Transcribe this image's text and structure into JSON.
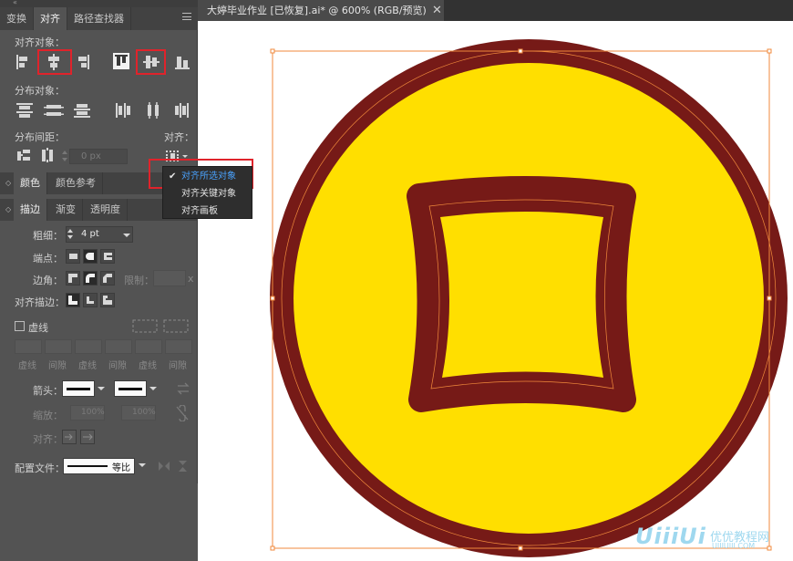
{
  "panel": {
    "tabs": [
      "变换",
      "对齐",
      "路径查找器"
    ],
    "align_objects_label": "对齐对象：",
    "distribute_objects_label": "分布对象：",
    "distribute_spacing_label": "分布间距：",
    "align_to_label": "对齐：",
    "spacing_value": "0 px",
    "align_to_menu": {
      "items": [
        "对齐所选对象",
        "对齐关键对象",
        "对齐画板"
      ],
      "selected": "对齐所选对象"
    },
    "color_tabs": [
      "颜色",
      "颜色参考"
    ],
    "stroke_tabs": [
      "描边",
      "渐变",
      "透明度"
    ],
    "stroke": {
      "weight_label": "粗细：",
      "weight_value": "4 pt",
      "cap_label": "端点：",
      "corner_label": "边角：",
      "limit_label": "限制：",
      "limit_x": "x",
      "align_stroke_label": "对齐描边：",
      "dashed_label": "虚线",
      "dash_labels": [
        "虚线",
        "间隙",
        "虚线",
        "间隙",
        "虚线",
        "间隙"
      ],
      "arrow_label": "箭头：",
      "scale_label": "缩放：",
      "scale_values": [
        "100%",
        "100%"
      ],
      "align_label": "对齐：",
      "profile_label": "配置文件：",
      "profile_value": "等比"
    }
  },
  "document": {
    "tab_title": "大婷毕业作业  [已恢复].ai* @ 600% (RGB/预览)",
    "close_glyph": "✕"
  },
  "artwork": {
    "outer_color": "#761a17",
    "fill_color": "#ffdf00",
    "selection_color": "#f08a3c"
  },
  "watermark": {
    "logo": "UiiiUi",
    "site_cn": "优优教程网",
    "site_url": "UIIIUIII.COM"
  },
  "colors": {
    "highlight": "#e0232b",
    "menu_selected": "#4aa3ff"
  }
}
